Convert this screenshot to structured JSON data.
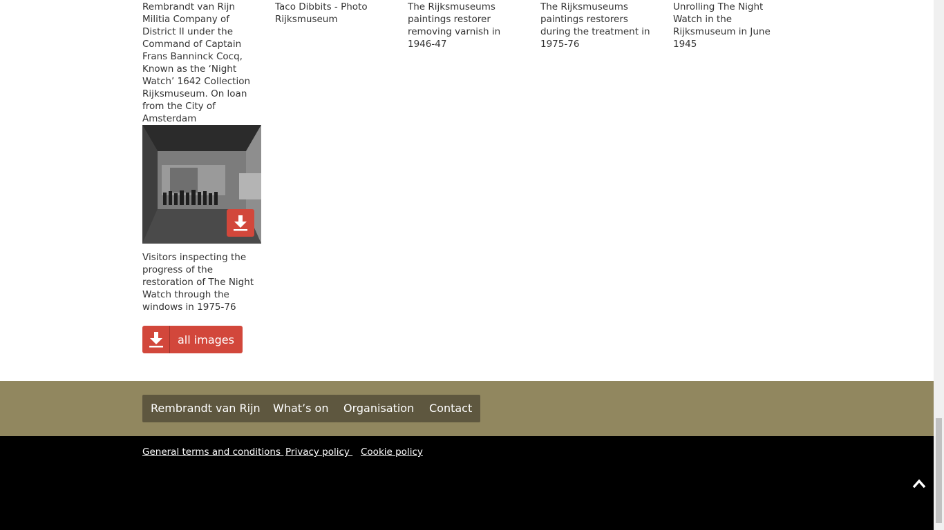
{
  "captions": [
    "Rembrandt van Rijn Militia Company of District II under the Command of Captain Frans Banninck Cocq, Known as the ‘Night Watch’ 1642 Collection Rijksmuseum. On loan from the City of Amsterdam",
    "Taco Dibbits - Photo Rijksmuseum",
    "The Rijksmuseums paintings restorer removing varnish in 1946-47",
    "The Rijksmuseums paintings restorers during the treatment in 1975-76",
    "Unrolling The Night Watch in the Rijksmuseum in June 1945"
  ],
  "tile": {
    "caption": "Visitors inspecting the progress of the restoration of The Night Watch through the windows in 1975-76",
    "download_icon": "download-icon"
  },
  "all_images": {
    "label": "all images",
    "icon": "download-icon"
  },
  "footer_nav": [
    "Rembrandt van Rijn",
    "What’s on",
    "Organisation",
    "Contact"
  ],
  "legal_links": [
    "General terms and conditions ",
    "Privacy policy ",
    "Cookie policy"
  ],
  "back_to_top_icon": "chevron-up-icon",
  "colors": {
    "accent_red": "#d2473b",
    "footer_nav_bg": "#91875f",
    "footer_nav_button": "#5e573f",
    "footer_bottom_bg": "#000000"
  }
}
